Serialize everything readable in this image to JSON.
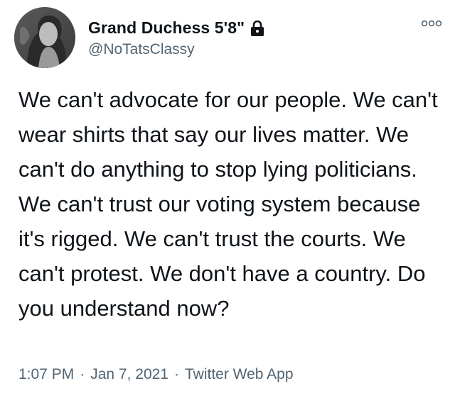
{
  "user": {
    "display_name": "Grand Duchess 5'8\"",
    "handle": "@NoTatsClassy",
    "protected_icon": "lock-icon",
    "avatar_icon": "profile-photo"
  },
  "menu_icon": "more-options-icon",
  "tweet": {
    "text": "We can't advocate for our people. We can't wear shirts that say our lives matter. We can't do anything to stop lying politicians. We can't trust our voting system because it's rigged. We can't trust the courts. We can't protest. We don't have a country. Do you understand now?",
    "time": "1:07 PM",
    "date": "Jan 7, 2021",
    "source": "Twitter Web App",
    "separator": "·"
  },
  "colors": {
    "text_primary": "#0f1419",
    "text_secondary": "#536471",
    "background": "#ffffff"
  }
}
